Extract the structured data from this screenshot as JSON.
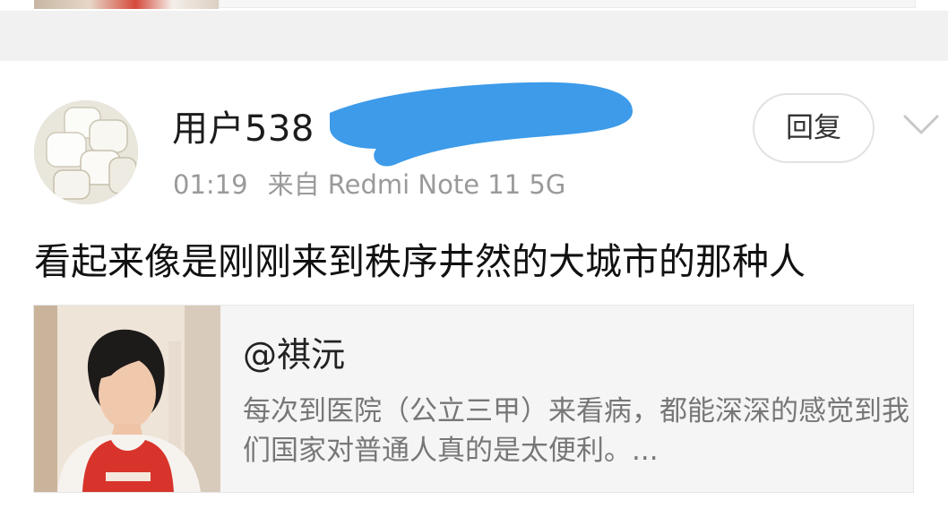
{
  "comment": {
    "username": "用户538",
    "time": "01:19",
    "source": "来自 Redmi Note 11 5G",
    "reply_label": "回复",
    "text": "看起来像是刚刚来到秩序井然的大城市的那种人"
  },
  "quote": {
    "author": "@祺沅",
    "excerpt": "每次到医院（公立三甲）来看病，都能深深的感觉到我们国家对普通人真的是太便利。..."
  },
  "icons": {
    "more": "chevron-down-icon"
  },
  "colors": {
    "redaction": "#3d9be9",
    "meta_gray": "#9a9a9a",
    "separator": "#f1f1f1"
  }
}
